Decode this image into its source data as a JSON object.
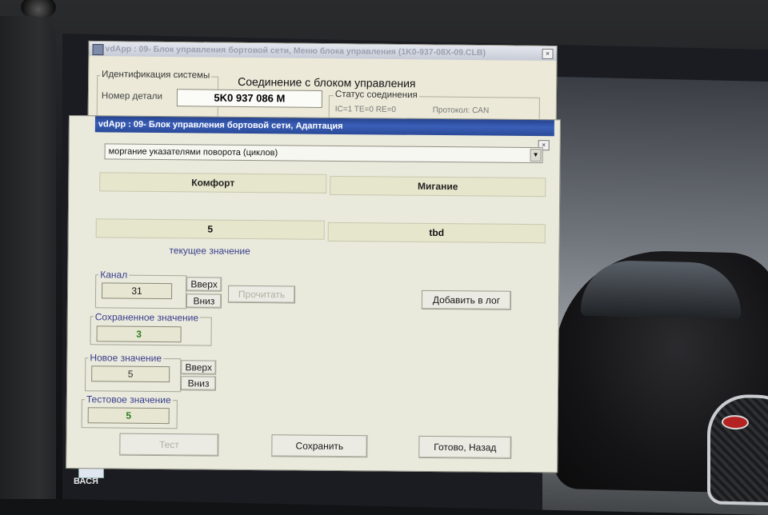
{
  "desktop": {
    "icon_label": "ВАСЯ"
  },
  "back_window": {
    "title": "vdApp : 09- Блок управления бортовой сети, Меню блока управления (1K0-937-08X-09.CLB)",
    "heading": "Соединение с блоком управления",
    "id_group": "Идентификация системы",
    "part_label": "Номер детали",
    "part_value": "5K0 937 086 M",
    "status_group": "Статус соединения",
    "status_text": "IC=1 TE=0 RE=0",
    "protocol_text": "Протокол: CAN",
    "close": "×"
  },
  "front_window": {
    "title": "vdApp : 09- Блок управления бортовой сети, Адаптация",
    "close": "×",
    "combo_value": "моргание указателями поворота (циклов)",
    "headers": [
      "Комфорт",
      "Мигание"
    ],
    "values": [
      "5",
      "tbd"
    ],
    "current_caption": "текущее значение",
    "channel": {
      "label": "Канал",
      "value": "31",
      "up": "Вверх",
      "down": "Вниз"
    },
    "read_button": "Прочитать",
    "add_log_button": "Добавить в лог",
    "saved": {
      "label": "Сохраненное значение",
      "value": "3"
    },
    "new_value": {
      "label": "Новое значение",
      "value": "5",
      "up": "Вверх",
      "down": "Вниз"
    },
    "test_value": {
      "label": "Тестовое значение",
      "value": "5"
    },
    "test_button": "Тест",
    "save_button": "Сохранить",
    "done_button": "Готово, Назад"
  },
  "colors": {
    "titlebar": "#2a4a98",
    "value_green": "#2e7d1e",
    "caption_blue": "#3a3f8c"
  }
}
